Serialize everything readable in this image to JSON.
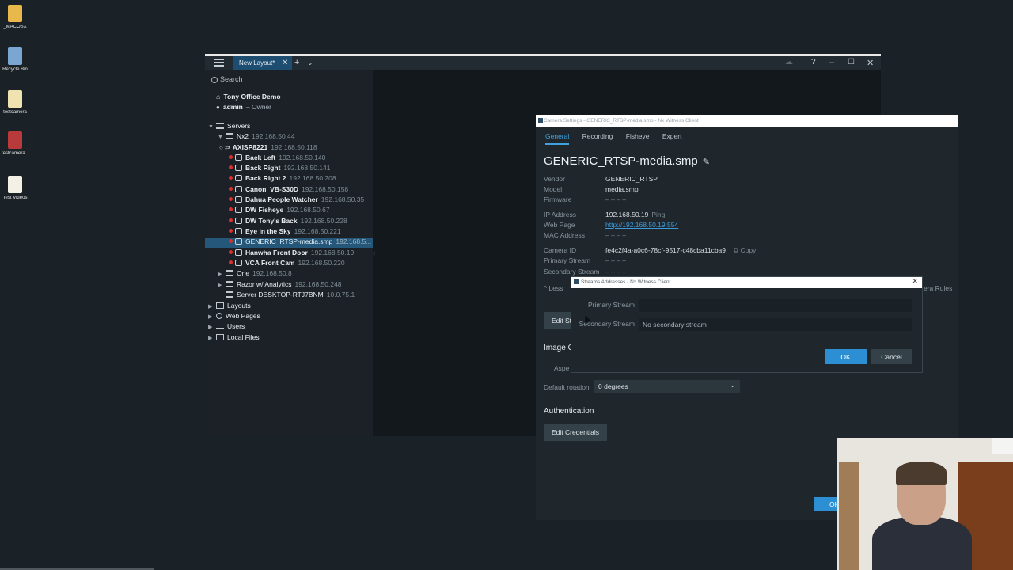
{
  "desktop": {
    "icons": [
      {
        "label": "_MACOSX",
        "color": "#e8b84a"
      },
      {
        "label": "Recycle Bin",
        "color": "#7aa7d1"
      },
      {
        "label": "testcamera",
        "color": "#f0e3b0"
      },
      {
        "label": "testcamera...",
        "color": "#b83a3a"
      },
      {
        "label": "Test Videos",
        "color": "#f3f0e6"
      }
    ]
  },
  "client": {
    "tab_label": "New Layout*",
    "search_placeholder": "Search",
    "system_name": "Tony Office Demo",
    "user": "admin",
    "user_role": "– Owner",
    "tree": {
      "servers_label": "Servers",
      "nx2": {
        "name": "Nx2",
        "ip": "192.168.50.44"
      },
      "cameras": [
        {
          "name": "AXISP8221",
          "ip": "192.168.50.118"
        },
        {
          "name": "Back Left",
          "ip": "192.168.50.140"
        },
        {
          "name": "Back Right",
          "ip": "192.168.50.141"
        },
        {
          "name": "Back Right 2",
          "ip": "192.168.50.208"
        },
        {
          "name": "Canon_VB-S30D",
          "ip": "192.168.50.158"
        },
        {
          "name": "Dahua People Watcher",
          "ip": "192.168.50.35"
        },
        {
          "name": "DW Fisheye",
          "ip": "192.168.50.67"
        },
        {
          "name": "DW Tony's Back",
          "ip": "192.168.50.228"
        },
        {
          "name": "Eye in the Sky",
          "ip": "192.168.50.221"
        },
        {
          "name": "GENERIC_RTSP-media.smp",
          "ip": "192.168.5..."
        },
        {
          "name": "Hanwha Front Door",
          "ip": "192.168.50.19"
        },
        {
          "name": "VCA Front Cam",
          "ip": "192.168.50.220"
        }
      ],
      "other_servers": [
        {
          "name": "One",
          "ip": "192.168.50.8"
        },
        {
          "name": "Razor w/ Analytics",
          "ip": "192.168.50.248"
        },
        {
          "name": "Server DESKTOP-RTJ7BNM",
          "ip": "10.0.75.1"
        }
      ],
      "sections": [
        "Layouts",
        "Web Pages",
        "Users",
        "Local Files"
      ]
    }
  },
  "camera_settings": {
    "window_title": "Camera Settings - GENERIC_RTSP-media.smp - Nx Witness Client",
    "tabs": [
      "General",
      "Recording",
      "Fisheye",
      "Expert"
    ],
    "active_tab": "General",
    "camera_name": "GENERIC_RTSP-media.smp",
    "fields": {
      "vendor_label": "Vendor",
      "vendor": "GENERIC_RTSP",
      "model_label": "Model",
      "model": "media.smp",
      "firmware_label": "Firmware",
      "firmware": "– – – –",
      "ip_label": "IP Address",
      "ip": "192.168.50.19",
      "ping": "Ping",
      "web_label": "Web Page",
      "web": "http://192.168.50.19:554",
      "mac_label": "MAC Address",
      "mac": "– – – –",
      "camid_label": "Camera ID",
      "camid": "fe4c2f4a-a0c6-78cf-9517-c48cba11cba9",
      "copy": "Copy",
      "primary_label": "Primary Stream",
      "primary": "– – – –",
      "secondary_label": "Secondary Stream",
      "secondary": "– – – –"
    },
    "less_info": "Less",
    "rules_text": "era Rules",
    "edit_streams_partial": "Edit St",
    "image_section_partial": "Image C",
    "aspect_partial": "Aspe",
    "default_rotation_label": "Default rotation",
    "default_rotation_value": "0 degrees",
    "auth_heading": "Authentication",
    "edit_credentials": "Edit Credentials",
    "ok_partial": "OK"
  },
  "streams_dialog": {
    "title": "Streams Addresses - Nx Witness Client",
    "primary_label": "Primary Stream",
    "primary_value": "",
    "secondary_label": "Secondary Stream",
    "secondary_placeholder": "No secondary stream",
    "ok": "OK",
    "cancel": "Cancel"
  }
}
